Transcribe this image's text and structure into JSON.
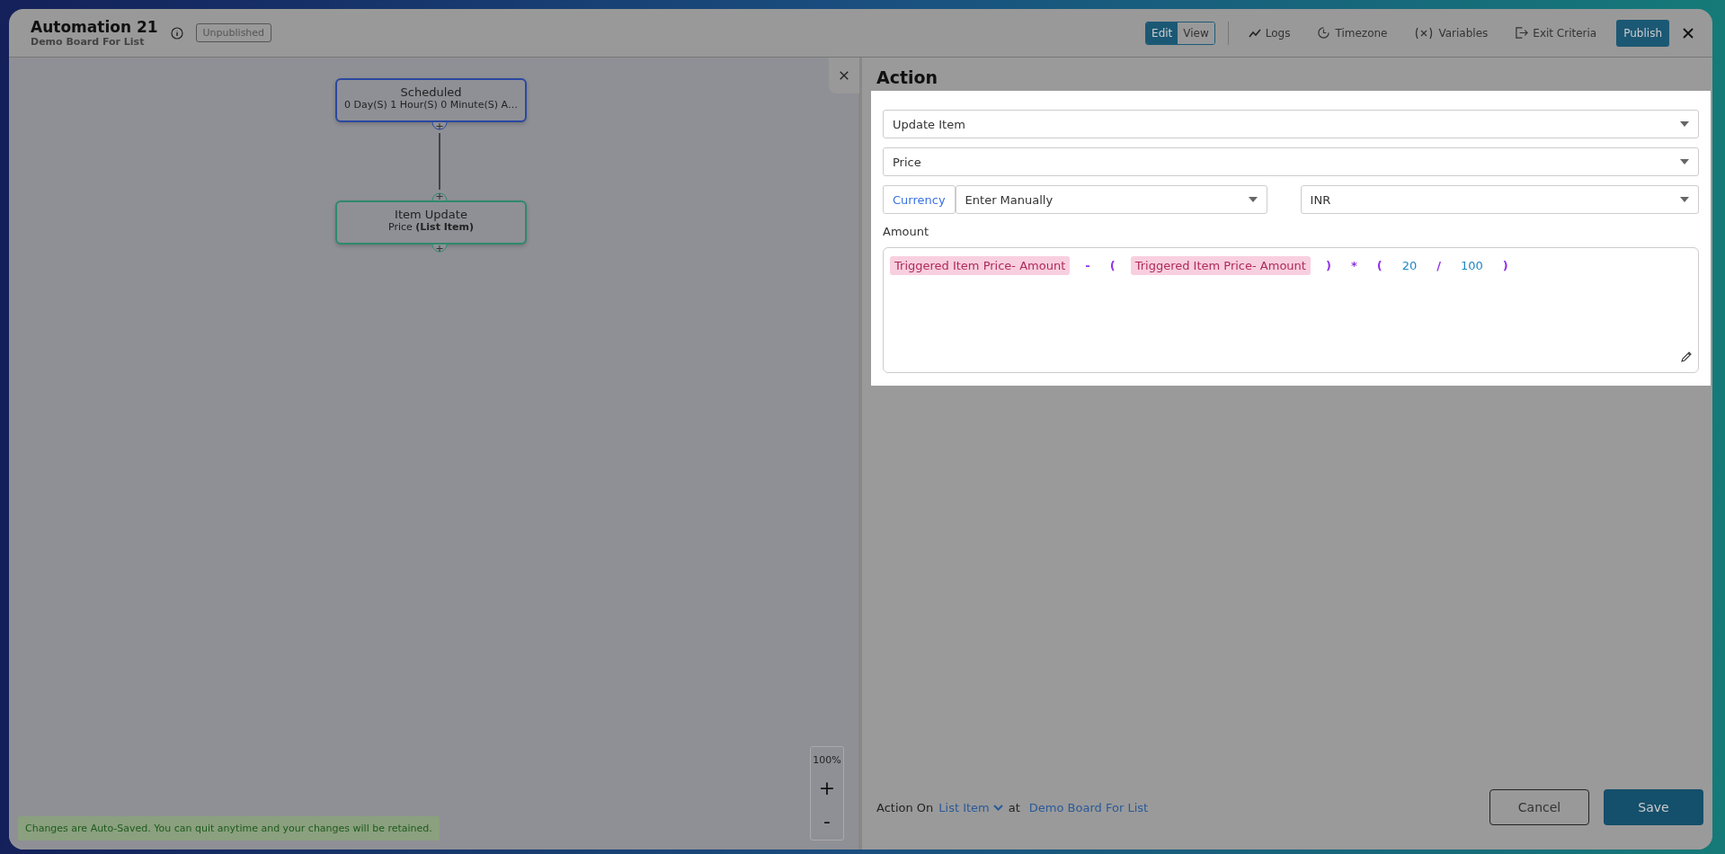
{
  "header": {
    "title": "Automation 21",
    "subtitle": "Demo Board For List",
    "status_badge": "Unpublished",
    "mode_toggle": [
      {
        "label": "Edit",
        "selected": true
      },
      {
        "label": "View",
        "selected": false
      }
    ],
    "tools": [
      {
        "kind": "logs",
        "label": "Logs"
      },
      {
        "kind": "timezone",
        "label": "Timezone"
      },
      {
        "kind": "variables",
        "label": "Variables"
      },
      {
        "kind": "exit",
        "label": "Exit Criteria"
      }
    ],
    "publish_button": "Publish"
  },
  "canvas": {
    "nodes": [
      {
        "title": "Scheduled",
        "subtitle": "0 Day(S) 1 Hour(S) 0 Minute(S) A…",
        "color": "#2a48a0"
      },
      {
        "title": "Item Update",
        "subtitle": "Price **(List Item)**",
        "color": "#2e8a6c"
      }
    ],
    "zoom": {
      "level": "100%",
      "zoom_in": "+",
      "zoom_out": "-"
    },
    "notice": "Changes are Auto-Saved. You can quit anytime and your changes will be retained."
  },
  "action_panel": {
    "title": "Action",
    "action_select": "Update Item",
    "field_select": "Price",
    "currency_label": "Currency",
    "currency_source": "Enter Manually",
    "currency_code": "INR",
    "amount_label": "Amount",
    "expression": [
      {
        "kind": "field",
        "text": "Triggered Item Price- Amount"
      },
      {
        "kind": "operator",
        "text": "-"
      },
      {
        "kind": "operator",
        "text": "("
      },
      {
        "kind": "field",
        "text": "Triggered Item Price- Amount"
      },
      {
        "kind": "operator",
        "text": ")"
      },
      {
        "kind": "operator",
        "text": "*"
      },
      {
        "kind": "operator",
        "text": "("
      },
      {
        "kind": "number",
        "text": "20"
      },
      {
        "kind": "operator",
        "text": "/"
      },
      {
        "kind": "number",
        "text": "100"
      },
      {
        "kind": "operator",
        "text": ")"
      }
    ],
    "footer": {
      "action_on_label": "Action On",
      "entity": "List Item",
      "at_label": "at",
      "board": "Demo Board For List",
      "cancel_button": "Cancel",
      "save_button": "Save"
    }
  }
}
